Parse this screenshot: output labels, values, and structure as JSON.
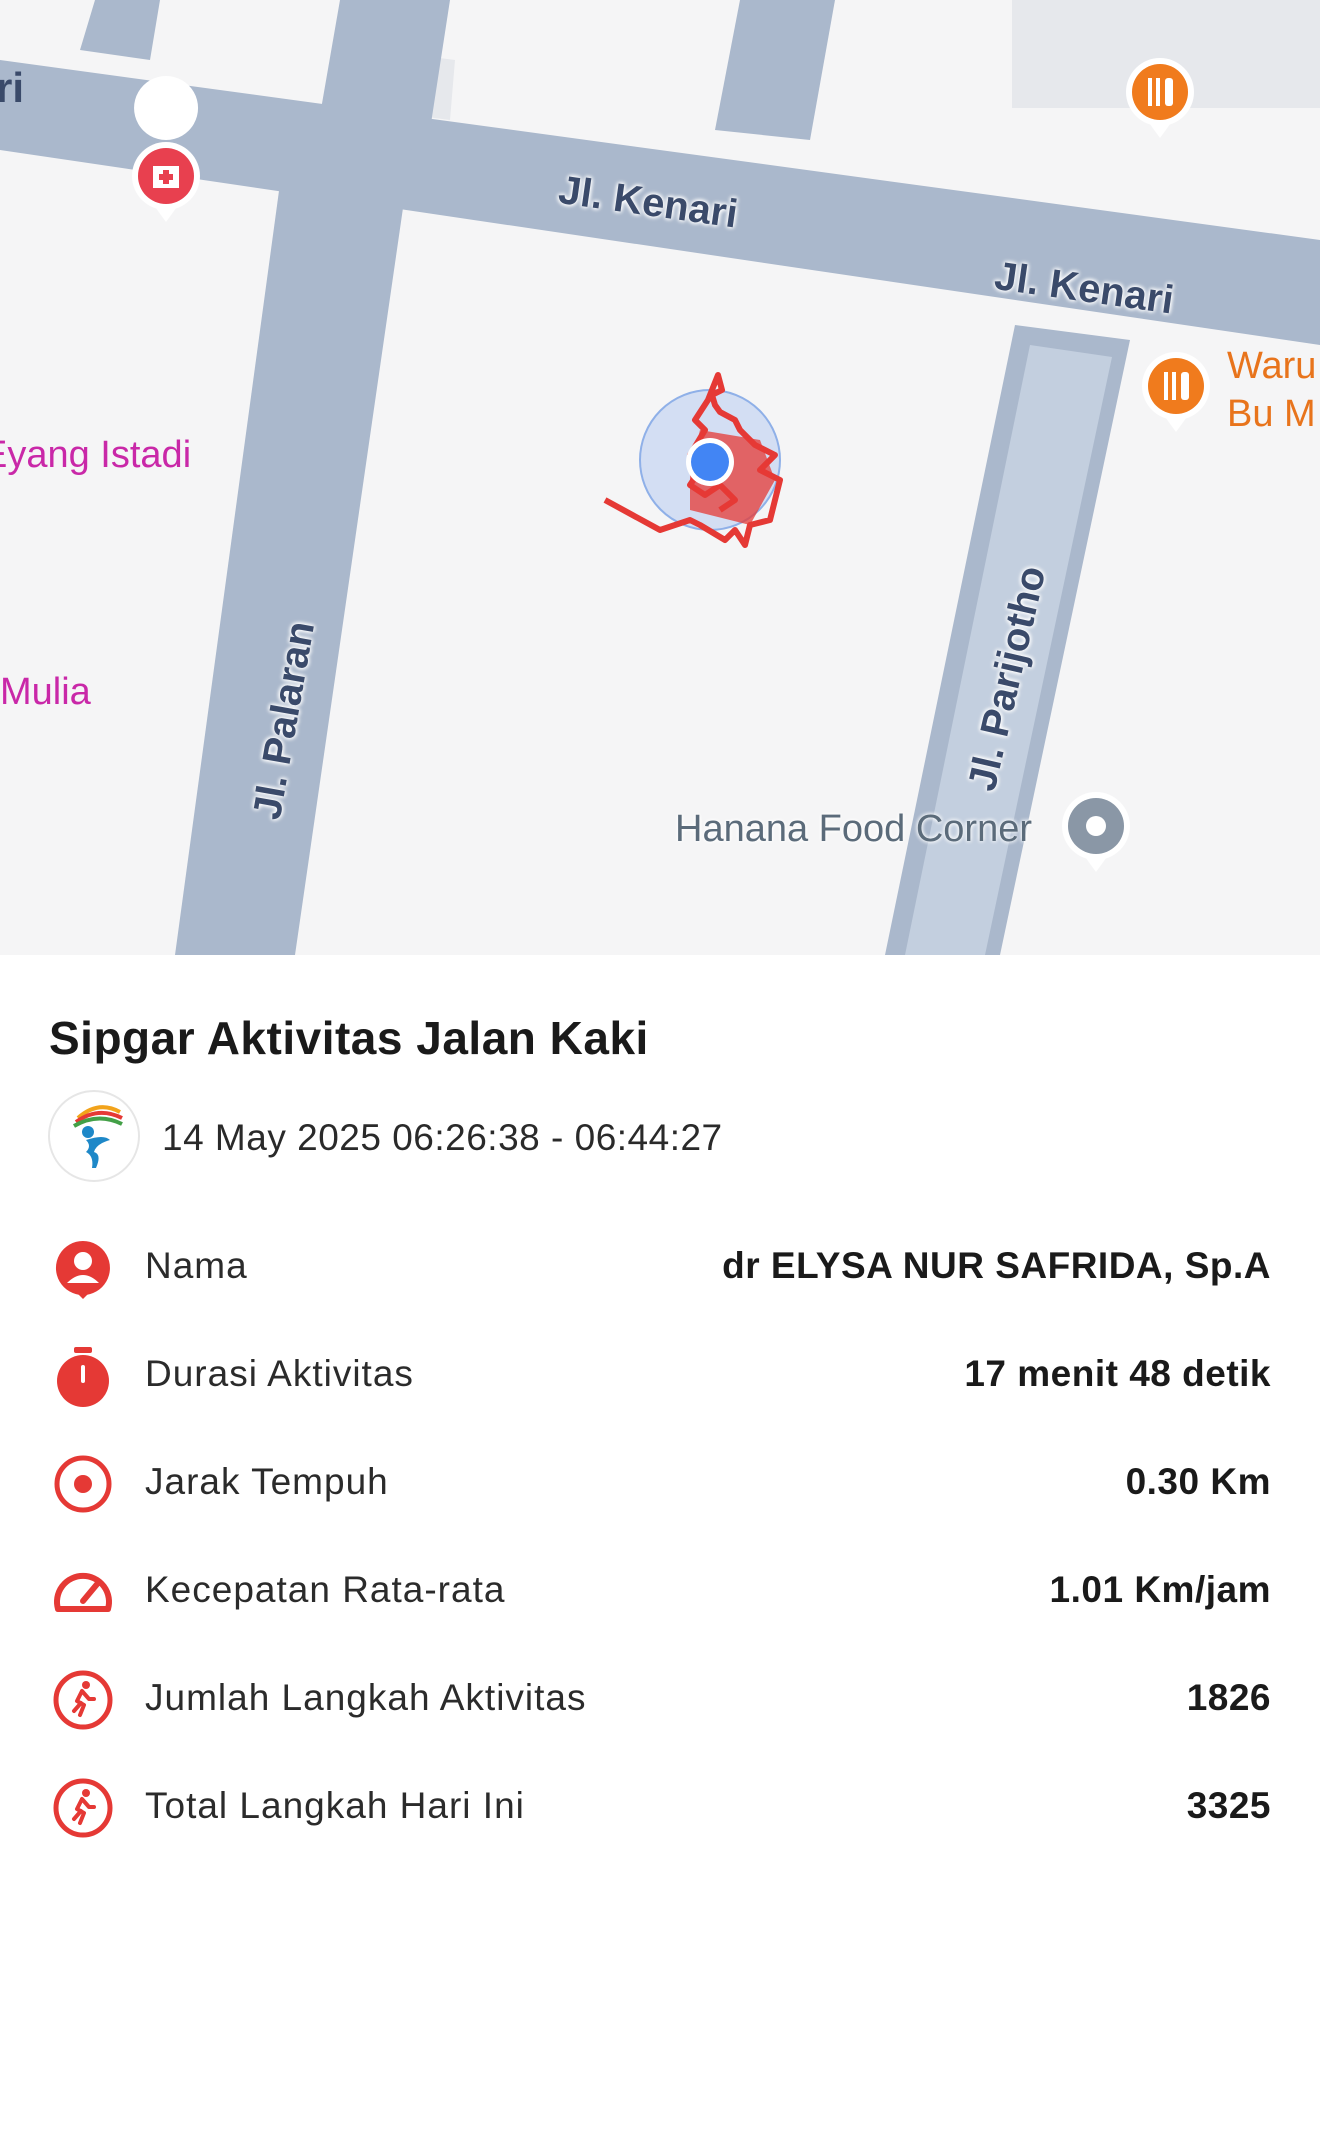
{
  "map": {
    "roads": [
      "Jl. Kenari",
      "Jl. Kenari",
      "Jl. Palaran",
      "Jl. Parijotho"
    ],
    "pois": {
      "left_top": "ri",
      "eyang": "Eyang Istadi",
      "mulia": "Mulia",
      "warung_line1": "Waru",
      "warung_line2": "Bu M",
      "hanana": "Hanana Food Corner"
    },
    "colors": {
      "road": "#aab8cc",
      "background": "#f5f5f6",
      "route": "#e53935",
      "location": "#4285f4"
    }
  },
  "activity": {
    "title": "Sipgar Aktivitas Jalan Kaki",
    "datetime": "14 May 2025 06:26:38 - 06:44:27",
    "rows": [
      {
        "icon": "user-icon",
        "label": "Nama",
        "value": "dr ELYSA NUR SAFRIDA, Sp.A"
      },
      {
        "icon": "stopwatch-icon",
        "label": "Durasi Aktivitas",
        "value": "17 menit 48 detik"
      },
      {
        "icon": "target-icon",
        "label": "Jarak Tempuh",
        "value": "0.30 Km"
      },
      {
        "icon": "speedometer-icon",
        "label": "Kecepatan Rata-rata",
        "value": "1.01 Km/jam"
      },
      {
        "icon": "walking-icon",
        "label": "Jumlah Langkah Aktivitas",
        "value": "1826"
      },
      {
        "icon": "walking-icon",
        "label": "Total Langkah Hari Ini",
        "value": "3325"
      }
    ],
    "accent": "#e53935"
  }
}
